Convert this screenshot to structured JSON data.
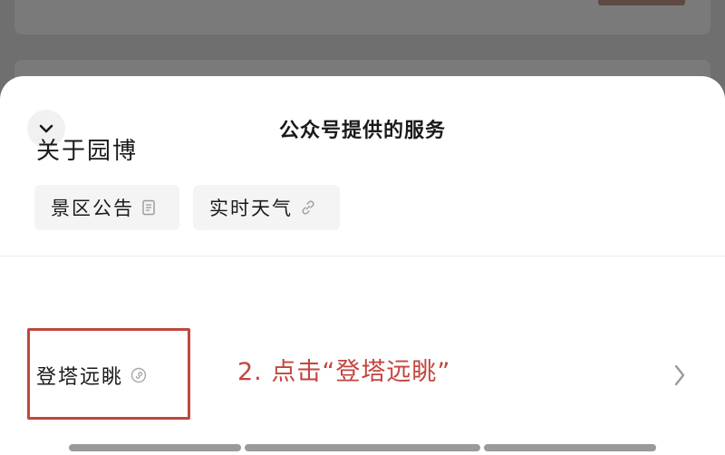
{
  "sheet": {
    "title": "公众号提供的服务",
    "collapse_icon": "chevron-down-icon"
  },
  "about_section": {
    "title": "关于园博",
    "chips": [
      {
        "label": "景区公告",
        "icon": "article-icon"
      },
      {
        "label": "实时天气",
        "icon": "link-icon"
      }
    ]
  },
  "service_row": {
    "label": "登塔远眺",
    "icon": "mini-program-icon",
    "chevron": "chevron-right-icon"
  },
  "annotation": {
    "text": "2. 点击“登塔远眺”",
    "color": "#c2453f"
  }
}
